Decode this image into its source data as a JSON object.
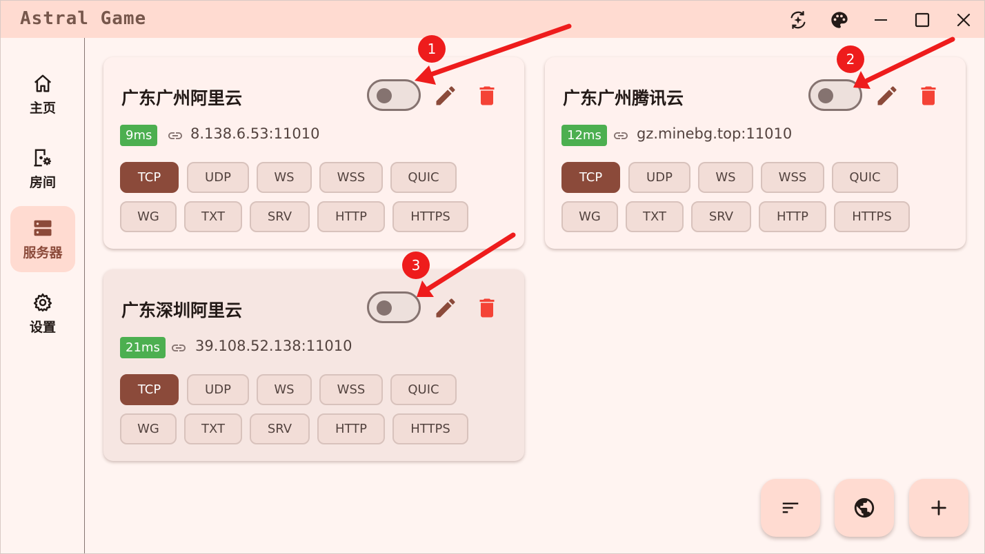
{
  "app": {
    "title": "Astral Game"
  },
  "titlebar": {
    "icons": [
      "theme-switch-icon",
      "palette-icon",
      "minimize-icon",
      "maximize-icon",
      "close-icon"
    ]
  },
  "sidebar": {
    "items": [
      {
        "label": "主页",
        "icon": "home-icon",
        "active": false
      },
      {
        "label": "房间",
        "icon": "room-settings-icon",
        "active": false
      },
      {
        "label": "服务器",
        "icon": "server-icon",
        "active": true
      },
      {
        "label": "设置",
        "icon": "gear-icon",
        "active": false
      }
    ]
  },
  "servers": [
    {
      "name": "广东广州阿里云",
      "latency": "9ms",
      "address": "8.138.6.53:11010",
      "enabled": false,
      "protocols": [
        "TCP",
        "UDP",
        "WS",
        "WSS",
        "QUIC",
        "WG",
        "TXT",
        "SRV",
        "HTTP",
        "HTTPS"
      ],
      "selected_protocol": "TCP"
    },
    {
      "name": "广东广州腾讯云",
      "latency": "12ms",
      "address": "gz.minebg.top:11010",
      "enabled": false,
      "protocols": [
        "TCP",
        "UDP",
        "WS",
        "WSS",
        "QUIC",
        "WG",
        "TXT",
        "SRV",
        "HTTP",
        "HTTPS"
      ],
      "selected_protocol": "TCP"
    },
    {
      "name": "广东深圳阿里云",
      "latency": "21ms",
      "address": "39.108.52.138:11010",
      "enabled": false,
      "protocols": [
        "TCP",
        "UDP",
        "WS",
        "WSS",
        "QUIC",
        "WG",
        "TXT",
        "SRV",
        "HTTP",
        "HTTPS"
      ],
      "selected_protocol": "TCP"
    }
  ],
  "annotations": {
    "badges": [
      "1",
      "2",
      "3"
    ]
  },
  "fabs": [
    {
      "icon": "sort-icon"
    },
    {
      "icon": "globe-icon"
    },
    {
      "icon": "add-icon"
    }
  ],
  "colors": {
    "titlebar": "#ffdbd1",
    "accent": "#8b4a3a",
    "latency_badge": "#4caf50",
    "delete": "#f44336",
    "annotation": "#ee1c1c"
  }
}
